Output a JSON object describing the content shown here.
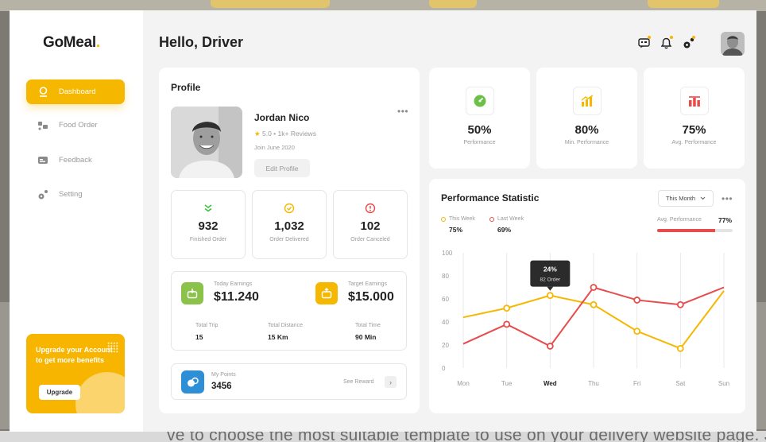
{
  "app": {
    "logo": "GoMeal",
    "logo_dot": ".",
    "greeting": "Hello, Driver"
  },
  "sidebar": {
    "items": [
      {
        "label": "Dashboard",
        "icon": "dashboard-icon",
        "active": true
      },
      {
        "label": "Food Order",
        "icon": "food-order-icon",
        "active": false
      },
      {
        "label": "Feedback",
        "icon": "feedback-icon",
        "active": false
      },
      {
        "label": "Setting",
        "icon": "setting-icon",
        "active": false
      }
    ],
    "upgrade": {
      "text": "Upgrade your Account to get more benefits",
      "button": "Upgrade"
    }
  },
  "header": {
    "icons": [
      "chat-icon",
      "bell-icon",
      "settings-icon"
    ],
    "avatar": "user-avatar"
  },
  "profile": {
    "title": "Profile",
    "name": "Jordan Nico",
    "rating_star": "★",
    "rating": "5.0 • 1k+ Reviews",
    "joined": "Join June 2020",
    "edit_button": "Edit Profile",
    "more": "•••",
    "stats": [
      {
        "value": "932",
        "label": "Finished Order",
        "icon": "double-chevron-icon",
        "color": "#3cc13b"
      },
      {
        "value": "1,032",
        "label": "Order Delivered",
        "icon": "check-circle-icon",
        "color": "#f5b700"
      },
      {
        "value": "102",
        "label": "Order Canceled",
        "icon": "alert-circle-icon",
        "color": "#e84b4b"
      }
    ],
    "earnings": {
      "today_label": "Today Earnings",
      "today_value": "$11.240",
      "target_label": "Target Earnings",
      "target_value": "$15.000",
      "trips": [
        {
          "label": "Total Trip",
          "value": "15"
        },
        {
          "label": "Total Distance",
          "value": "15 Km"
        },
        {
          "label": "Total Time",
          "value": "90 Min"
        }
      ]
    },
    "points": {
      "label": "My Points",
      "value": "3456",
      "link": "See Reward",
      "arrow": "›"
    }
  },
  "performance_cards": [
    {
      "value": "50%",
      "label": "Performance",
      "icon": "speedometer-icon",
      "color": "#3cc13b"
    },
    {
      "value": "80%",
      "label": "Min. Performance",
      "icon": "bar-chart-icon",
      "color": "#f5b700"
    },
    {
      "value": "75%",
      "label": "Avg. Performance",
      "icon": "gift-chart-icon",
      "color": "#e84b4b"
    }
  ],
  "statistic": {
    "title": "Performance Statistic",
    "period": "This Month",
    "more": "•••",
    "this_week_label": "This Week",
    "this_week_value": "75%",
    "last_week_label": "Last Week",
    "last_week_value": "69%",
    "avg_label": "Avg. Performance",
    "avg_value": "77%",
    "avg_fraction": 0.77,
    "tooltip_value": "24%",
    "tooltip_sub": "82 Order"
  },
  "chart_data": {
    "type": "line",
    "categories": [
      "Mon",
      "Tue",
      "Wed",
      "Thu",
      "Fri",
      "Sat",
      "Sun"
    ],
    "highlighted_category": "Wed",
    "ylim": [
      0,
      100
    ],
    "yticks": [
      0,
      20,
      40,
      60,
      80,
      100
    ],
    "series": [
      {
        "name": "This Week",
        "color": "#f5b700",
        "values": [
          44,
          52,
          63,
          55,
          32,
          17,
          67
        ]
      },
      {
        "name": "Last Week",
        "color": "#e84b4b",
        "values": [
          21,
          38,
          19,
          70,
          59,
          55,
          70
        ]
      }
    ],
    "grid": "vertical"
  },
  "colors": {
    "accent": "#f5b700",
    "red": "#e84b4b",
    "green": "#3cc13b",
    "blue": "#2f8fd6"
  },
  "background_text": "ve to choose the most suitable template to use on your delivery website page. Just like our"
}
